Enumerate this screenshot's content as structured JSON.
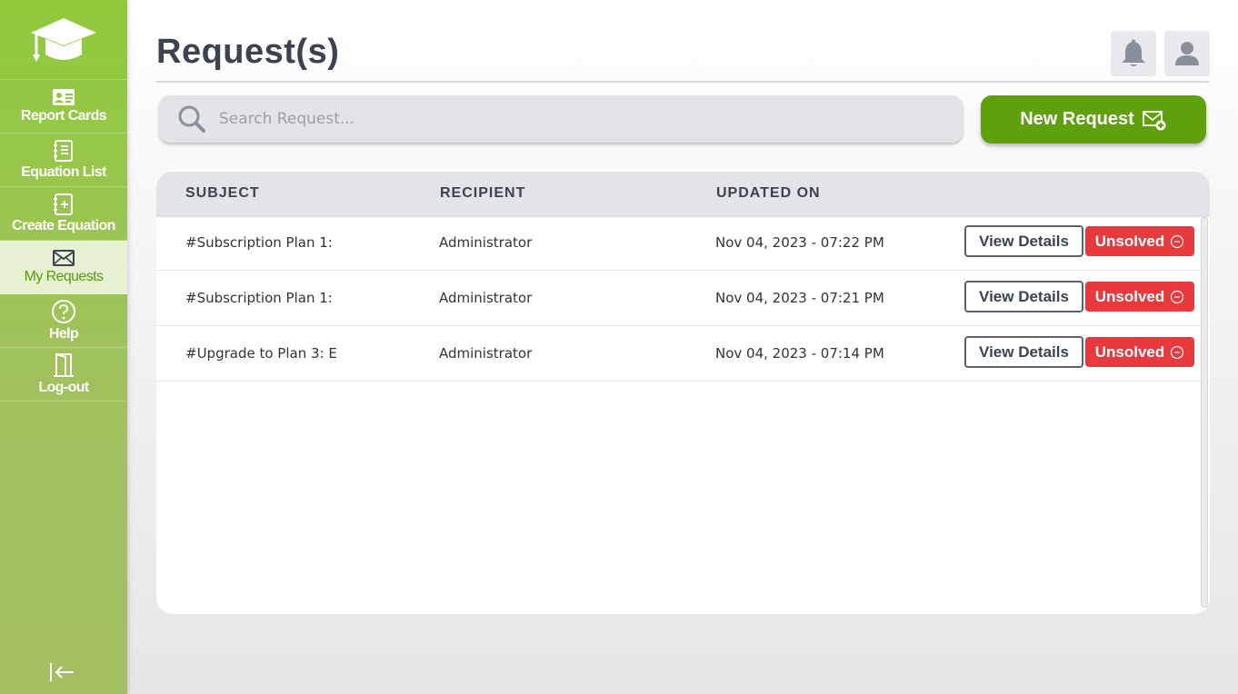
{
  "sidebar": {
    "items": [
      {
        "label": "Report Cards",
        "icon": "id-card-icon"
      },
      {
        "label": "Equation List",
        "icon": "notebook-list-icon"
      },
      {
        "label": "Create Equation",
        "icon": "notebook-plus-icon"
      },
      {
        "label": "My Requests",
        "icon": "envelope-icon",
        "active": true
      },
      {
        "label": "Help",
        "icon": "question-circle-icon"
      },
      {
        "label": "Log-out",
        "icon": "door-icon"
      }
    ]
  },
  "header": {
    "title": "Request(s)"
  },
  "search": {
    "placeholder": "Search Request..."
  },
  "actions": {
    "new_request_label": "New Request"
  },
  "table": {
    "headers": [
      "SUBJECT",
      "RECIPIENT",
      "UPDATED ON"
    ],
    "rows": [
      {
        "subject": "#Subscription Plan 1:",
        "recipient": "Administrator",
        "updated": "Nov 04, 2023 - 07:22 PM",
        "view_label": "View Details",
        "status": "Unsolved"
      },
      {
        "subject": "#Subscription Plan 1:",
        "recipient": "Administrator",
        "updated": "Nov 04, 2023 - 07:21 PM",
        "view_label": "View Details",
        "status": "Unsolved"
      },
      {
        "subject": "#Upgrade to Plan 3: E",
        "recipient": "Administrator",
        "updated": "Nov 04, 2023 - 07:14 PM",
        "view_label": "View Details",
        "status": "Unsolved"
      }
    ]
  },
  "colors": {
    "sidebar_green": "#8fcb3a",
    "primary_green": "#5fa00d",
    "unsolved_red": "#e8393c",
    "heading_dark": "#3a4350"
  }
}
